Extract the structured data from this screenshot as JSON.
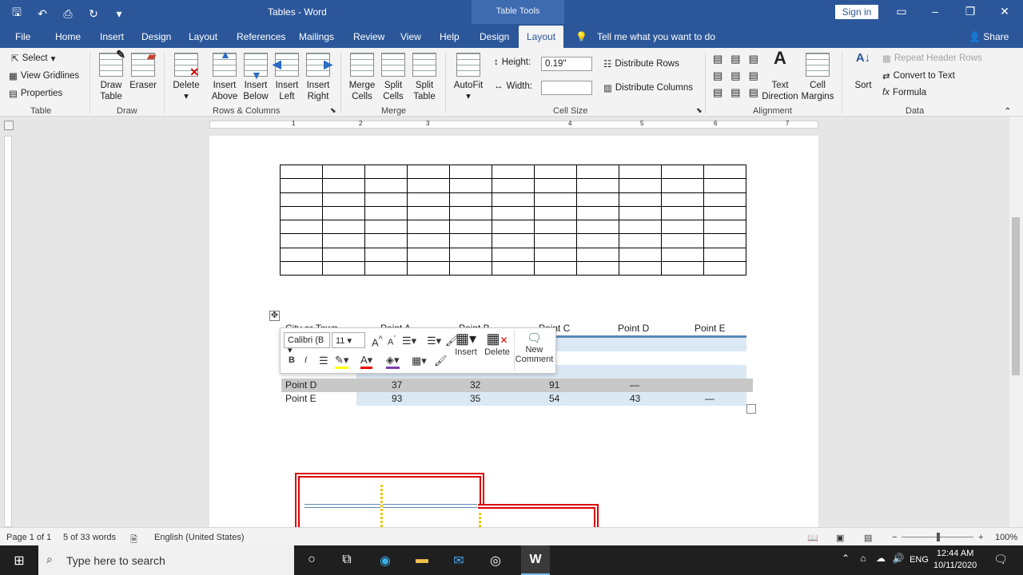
{
  "window": {
    "title": "Tables - Word",
    "context_tab_group": "Table Tools",
    "sign_in": "Sign in"
  },
  "tabs": [
    "File",
    "Home",
    "Insert",
    "Design",
    "Layout",
    "References",
    "Mailings",
    "Review",
    "View",
    "Help",
    "Design",
    "Layout"
  ],
  "active_tab_index": 11,
  "tell_me": "Tell me what you want to do",
  "share": "Share",
  "ribbon": {
    "table": {
      "label": "Table",
      "select": "Select",
      "gridlines": "View Gridlines",
      "properties": "Properties"
    },
    "draw": {
      "label": "Draw",
      "draw_table": "Draw Table",
      "eraser": "Eraser"
    },
    "rows_columns": {
      "label": "Rows & Columns",
      "delete": "Delete",
      "insert_above": "Insert Above",
      "insert_below": "Insert Below",
      "insert_left": "Insert Left",
      "insert_right": "Insert Right"
    },
    "merge": {
      "label": "Merge",
      "merge_cells": "Merge Cells",
      "split_cells": "Split Cells",
      "split_table": "Split Table"
    },
    "cell_size": {
      "label": "Cell Size",
      "autofit": "AutoFit",
      "height_label": "Height:",
      "height_value": "0.19\"",
      "width_label": "Width:",
      "width_value": "",
      "distribute_rows": "Distribute Rows",
      "distribute_columns": "Distribute Columns"
    },
    "alignment": {
      "label": "Alignment",
      "text_direction": "Text Direction",
      "cell_margins": "Cell Margins"
    },
    "data": {
      "label": "Data",
      "sort": "Sort",
      "repeat_header": "Repeat Header Rows",
      "convert": "Convert to Text",
      "formula": "Formula"
    }
  },
  "ruler_numbers": [
    "1",
    "2",
    "3",
    "4",
    "5",
    "6",
    "7"
  ],
  "data_table": {
    "headers": [
      "City or Town",
      "Point A",
      "Point B",
      "Point C",
      "Point D",
      "Point E"
    ],
    "rows": [
      [
        "Point D",
        "37",
        "32",
        "91",
        "—",
        ""
      ],
      [
        "Point E",
        "93",
        "35",
        "54",
        "43",
        "—"
      ]
    ]
  },
  "minibar": {
    "font": "Calibri (B",
    "size": "11",
    "insert": "Insert",
    "delete": "Delete",
    "new_comment_1": "New",
    "new_comment_2": "Comment"
  },
  "status": {
    "page": "Page 1 of 1",
    "words": "5 of 33 words",
    "language": "English (United States)",
    "zoom": "100%"
  },
  "taskbar": {
    "search": "Type here to search",
    "time": "12:44 AM",
    "date": "10/11/2020",
    "lang": "ENG"
  }
}
